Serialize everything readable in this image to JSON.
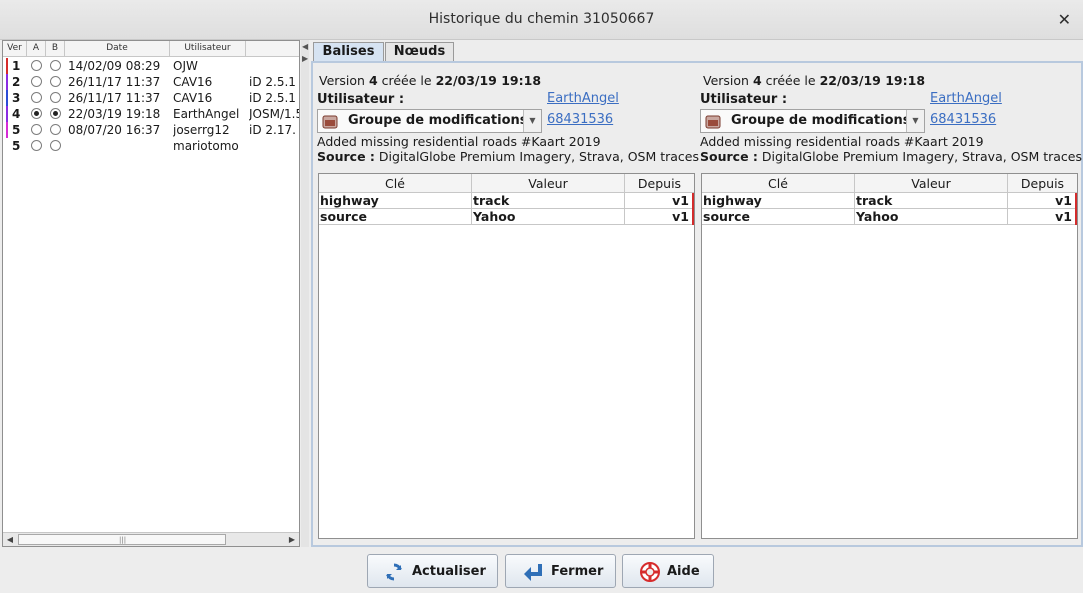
{
  "window": {
    "title": "Historique du chemin 31050667"
  },
  "versions_table": {
    "columns": [
      "Ver",
      "A",
      "B",
      "Date",
      "Utilisateur",
      ""
    ],
    "rows": [
      {
        "ver": "1",
        "date": "14/02/09 08:29",
        "user": "OJW",
        "editor": "",
        "a": false,
        "b": false,
        "bar_color": "#d62b2b"
      },
      {
        "ver": "2",
        "date": "26/11/17 11:37",
        "user": "CAV16",
        "editor": "iD 2.5.1",
        "a": false,
        "b": false,
        "bar_color": "#8a2be2"
      },
      {
        "ver": "3",
        "date": "26/11/17 11:37",
        "user": "CAV16",
        "editor": "iD 2.5.1",
        "a": false,
        "b": false,
        "bar_color": "#2b4bd6"
      },
      {
        "ver": "4",
        "date": "22/03/19 19:18",
        "user": "EarthAngel",
        "editor": "JOSM/1.5",
        "a": true,
        "b": true,
        "bar_color": "#8a2be2"
      },
      {
        "ver": "5",
        "date": "08/07/20 16:37",
        "user": "joserrg12",
        "editor": "iD 2.17.",
        "a": false,
        "b": false,
        "bar_color": "#d62bd6"
      },
      {
        "ver": "5",
        "date": "",
        "user": "mariotomo",
        "editor": "",
        "a": false,
        "b": false,
        "bar_color": ""
      }
    ]
  },
  "tabs": [
    {
      "label": "Balises",
      "active": true
    },
    {
      "label": "Nœuds",
      "active": false
    }
  ],
  "left_detail": {
    "version_prefix": "Version ",
    "version_num": "4",
    "created_text": " créée le ",
    "created_date": "22/03/19 19:18",
    "user_label": "Utilisateur :",
    "user_link": "EarthAngel",
    "changeset_label": "Groupe de modifications",
    "changeset_link": "68431536",
    "comment": "Added missing residential roads #Kaart 2019",
    "source_label": "Source :",
    "source_value": " DigitalGlobe Premium Imagery, Strava, OSM traces"
  },
  "right_detail": {
    "version_prefix": "Version ",
    "version_num": "4",
    "created_text": " créée le ",
    "created_date": "22/03/19 19:18",
    "user_label": "Utilisateur :",
    "user_link": "EarthAngel",
    "changeset_label": "Groupe de modifications",
    "changeset_link": "68431536",
    "comment": "Added missing residential roads #Kaart 2019",
    "source_label": "Source :",
    "source_value": " DigitalGlobe Premium Imagery, Strava, OSM traces"
  },
  "tag_table": {
    "columns": [
      "Clé",
      "Valeur",
      "Depuis"
    ],
    "rows": [
      {
        "key": "highway",
        "value": "track",
        "since": "v1"
      },
      {
        "key": "source",
        "value": "Yahoo",
        "since": "v1"
      }
    ]
  },
  "buttons": {
    "refresh": "Actualiser",
    "close": "Fermer",
    "help": "Aide"
  },
  "colors": {
    "accent_tab": "#d6e3f2",
    "link": "#3b6ec2",
    "change_bar": "#d32b2b"
  }
}
